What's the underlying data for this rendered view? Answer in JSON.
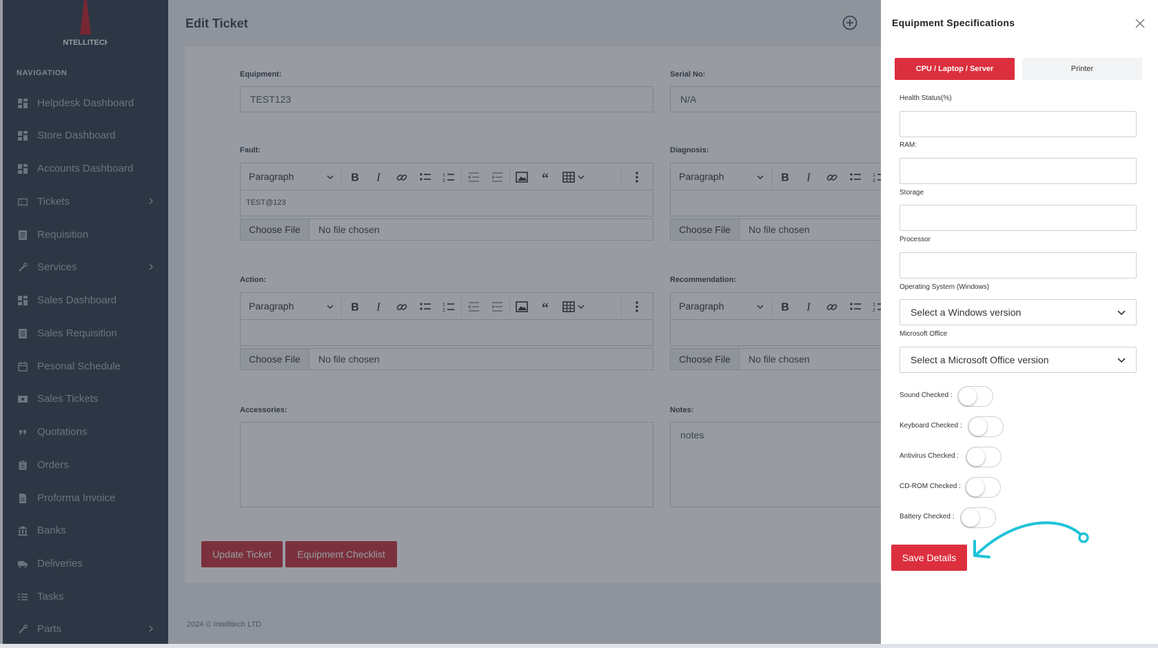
{
  "brand": {
    "logo_text": "INTELLITECH"
  },
  "sidebar": {
    "heading": "NAVIGATION",
    "items": [
      {
        "label": "Helpdesk Dashboard",
        "icon": "dashboard-icon",
        "has_submenu": false
      },
      {
        "label": "Store Dashboard",
        "icon": "dashboard-icon",
        "has_submenu": false
      },
      {
        "label": "Accounts Dashboard",
        "icon": "dashboard-icon",
        "has_submenu": false
      },
      {
        "label": "Tickets",
        "icon": "ticket-icon",
        "has_submenu": true
      },
      {
        "label": "Requisition",
        "icon": "list-icon",
        "has_submenu": false
      },
      {
        "label": "Services",
        "icon": "wrench-icon",
        "has_submenu": true
      },
      {
        "label": "Sales Dashboard",
        "icon": "dashboard-icon",
        "has_submenu": false
      },
      {
        "label": "Sales Requisition",
        "icon": "list-icon",
        "has_submenu": false
      },
      {
        "label": "Pesonal Schedule",
        "icon": "calendar-icon",
        "has_submenu": false
      },
      {
        "label": "Sales Tickets",
        "icon": "ticket-icon",
        "has_submenu": false
      },
      {
        "label": "Quotations",
        "icon": "quote-icon",
        "has_submenu": false
      },
      {
        "label": "Orders",
        "icon": "clipboard-icon",
        "has_submenu": false
      },
      {
        "label": "Proforma Invoice",
        "icon": "document-icon",
        "has_submenu": false
      },
      {
        "label": "Banks",
        "icon": "bank-icon",
        "has_submenu": false
      },
      {
        "label": "Deliveries",
        "icon": "truck-icon",
        "has_submenu": false
      },
      {
        "label": "Tasks",
        "icon": "tasks-icon",
        "has_submenu": false
      },
      {
        "label": "Parts",
        "icon": "wrench-icon",
        "has_submenu": true
      }
    ]
  },
  "page": {
    "title": "Edit Ticket"
  },
  "form": {
    "equipment": {
      "label": "Equipment:",
      "value": "TEST123"
    },
    "serial": {
      "label": "Serial No:",
      "value": "N/A"
    },
    "fault": {
      "label": "Fault:",
      "content": "TEST@123"
    },
    "diagnosis": {
      "label": "Diagnosis:",
      "content": ""
    },
    "action": {
      "label": "Action:",
      "content": ""
    },
    "recommendation": {
      "label": "Recommendation:",
      "content": ""
    },
    "accessories": {
      "label": "Accessories:",
      "value": ""
    },
    "notes": {
      "label": "Notes:",
      "value": "notes"
    },
    "toolbar": {
      "paragraph": "Paragraph"
    },
    "file": {
      "button": "Choose File",
      "status": "No file chosen"
    },
    "update_button": "Update Ticket",
    "checklist_button": "Equipment Checklist"
  },
  "footer": {
    "text": "2024 © Intellitech LTD"
  },
  "panel": {
    "title": "Equipment Specifications",
    "tabs": [
      {
        "label": "CPU / Laptop / Server",
        "active": true
      },
      {
        "label": "Printer",
        "active": false
      }
    ],
    "fields": {
      "health": {
        "label": "Health Status(%)",
        "value": ""
      },
      "ram": {
        "label": "RAM:",
        "value": ""
      },
      "storage": {
        "label": "Storage",
        "value": ""
      },
      "processor": {
        "label": "Processor",
        "value": ""
      },
      "os": {
        "label": "Operating System (Windows)",
        "selected": "Select a Windows version"
      },
      "office": {
        "label": "Microsoft Office",
        "selected": "Select a Microsoft Office version"
      }
    },
    "toggles": [
      {
        "label": "Sound Checked :",
        "on": false
      },
      {
        "label": "Keyboard Checked :",
        "on": false
      },
      {
        "label": "Antivirus Checked :",
        "on": false
      },
      {
        "label": "CD-ROM Checked :",
        "on": false
      },
      {
        "label": "Battery Checked :",
        "on": false
      }
    ],
    "save_button": "Save Details"
  },
  "colors": {
    "sidebar_bg": "#303c4c",
    "primary_red": "#dc2f3e",
    "annotation_arrow": "#1ec3d8"
  }
}
